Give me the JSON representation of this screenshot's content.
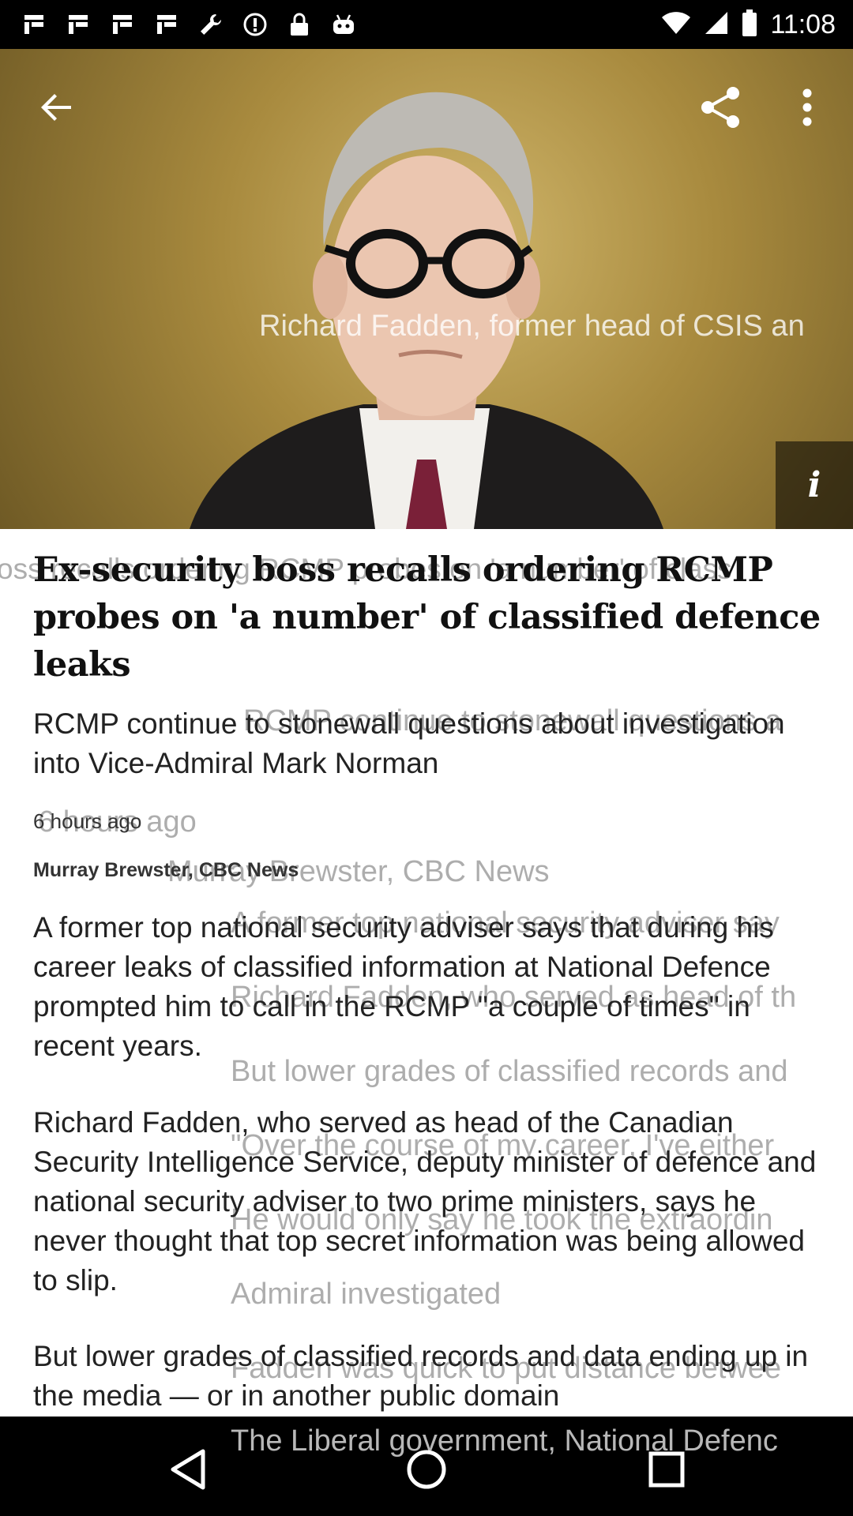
{
  "status_bar": {
    "time": "11:08",
    "icons": [
      "notification-icon",
      "notification-icon",
      "notification-icon",
      "notification-icon",
      "wrench-icon",
      "alert-icon",
      "lock-icon",
      "android-icon"
    ]
  },
  "hero": {
    "caption_overlay": "Richard Fadden, former head of CSIS an",
    "info_label": "i"
  },
  "article": {
    "headline_ghost": "oss recalls ordering RCMP probes on 'a number' of class",
    "headline": "Ex-security boss recalls ordering RCMP probes on 'a number' of classified defence leaks",
    "subhead_ghost": "RCMP continue to stonewall questions a",
    "subhead": "RCMP continue to stonewall questions about investigation into Vice-Admiral Mark Norman",
    "timestamp": "6 hours ago",
    "timestamp_ghost": "6 hours ago",
    "byline": "Murray Brewster, CBC News",
    "byline_ghost": "Murray Brewster, CBC News",
    "paragraphs": [
      "A former top national security adviser says that during his career leaks of classified information at National Defence prompted him to call in the RCMP \"a couple of times\" in recent years.",
      "Richard Fadden, who served as head of the Canadian Security Intelligence Service, deputy minister of defence and national security adviser to two prime ministers, says he never thought that top secret information was being allowed to slip.",
      "But lower grades of classified records and data ending up in the media — or in another public domain"
    ],
    "ghost_lines": [
      "A former top national security adviser say",
      "Richard Fadden, who served as head of th",
      "But lower grades of classified records and",
      "\"Over the course of my career, I've either",
      "He would only say he took the extraordin",
      "Admiral investigated",
      "Fadden was quick to put distance betwee",
      "The Liberal government, National Defenc"
    ]
  },
  "colors": {
    "status_bar": "#000000",
    "nav_bar": "#000000",
    "headline_text": "#111111"
  }
}
